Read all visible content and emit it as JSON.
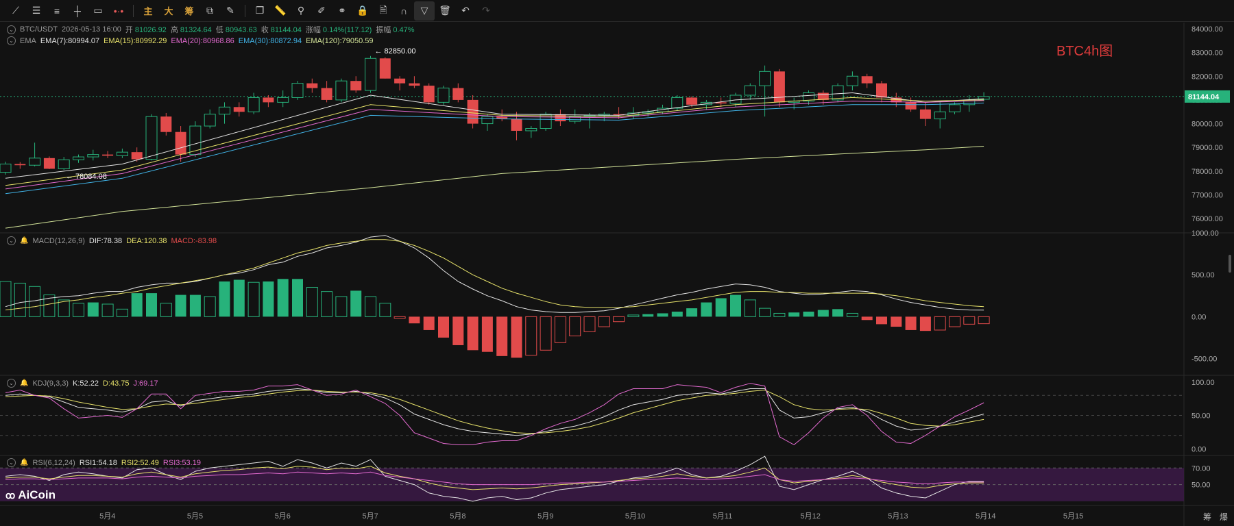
{
  "toolbar": {
    "cn_buttons": [
      "主",
      "大",
      "筹"
    ]
  },
  "header": {
    "symbol": "BTC/USDT",
    "datetime": "2026-05-13 16:00",
    "open_label": "开",
    "open": "81026.92",
    "high_label": "高",
    "high": "81324.64",
    "low_label": "低",
    "low": "80943.63",
    "close_label": "收",
    "close": "81144.04",
    "change_label": "涨幅",
    "change": "0.14%(117.12)",
    "amplitude_label": "振幅",
    "amplitude": "0.47%"
  },
  "ema_legend": {
    "name": "EMA",
    "ema7": "EMA(7):80994.07",
    "ema15": "EMA(15):80992.29",
    "ema20": "EMA(20):80968.86",
    "ema30": "EMA(30):80872.94",
    "ema120": "EMA(120):79050.59"
  },
  "macd_legend": {
    "name": "MACD(12,26,9)",
    "dif": "DIF:78.38",
    "dea": "DEA:120.38",
    "macd": "MACD:-83.98"
  },
  "kdj_legend": {
    "name": "KDJ(9,3,3)",
    "k": "K:52.22",
    "d": "D:43.75",
    "j": "J:69.17"
  },
  "rsi_legend": {
    "name": "RSI(6,12,24)",
    "rsi1": "RSI1:54.18",
    "rsi2": "RSI2:52.49",
    "rsi3": "RSI3:53.19"
  },
  "title_note": "BTC4h图",
  "annotations": {
    "high_marker": "82850.00",
    "low_marker": "78084.08"
  },
  "current_price": "81144.04",
  "logo_text": "AiCoin",
  "bottom_right": [
    "筹",
    "爆"
  ],
  "colors": {
    "up": "#27b27b",
    "down": "#e24b4b",
    "background": "#121212",
    "price_tag": "#27b27b",
    "title_note": "#e03c3c"
  },
  "chart_data": {
    "type": "candlestick",
    "interval": "4h",
    "x_ticks": [
      "5月4",
      "5月5",
      "5月6",
      "5月7",
      "5月8",
      "5月9",
      "5月10",
      "5月11",
      "5月12",
      "5月13",
      "5月14",
      "5月15"
    ],
    "price_axis": {
      "ticks": [
        "84000.00",
        "83000.00",
        "82000.00",
        "81000.00",
        "80000.00",
        "79000.00",
        "78000.00",
        "77000.00",
        "76000.00"
      ],
      "ylim": [
        75400,
        84200
      ]
    },
    "candles": [
      [
        77950,
        78400,
        77850,
        78300
      ],
      [
        78300,
        78380,
        78100,
        78250
      ],
      [
        78250,
        79200,
        78200,
        78550
      ],
      [
        78550,
        78620,
        78084.08,
        78100
      ],
      [
        78100,
        78600,
        78050,
        78480
      ],
      [
        78480,
        78700,
        78350,
        78600
      ],
      [
        78600,
        78900,
        78450,
        78700
      ],
      [
        78700,
        78850,
        78550,
        78650
      ],
      [
        78650,
        78950,
        78550,
        78800
      ],
      [
        78800,
        79000,
        78400,
        78500
      ],
      [
        78500,
        80400,
        78450,
        80300
      ],
      [
        80300,
        80450,
        79500,
        79650
      ],
      [
        79650,
        79900,
        78400,
        78700
      ],
      [
        78700,
        80100,
        78600,
        79900
      ],
      [
        79900,
        80600,
        79800,
        80400
      ],
      [
        80400,
        80900,
        80000,
        80700
      ],
      [
        80700,
        80900,
        80300,
        80500
      ],
      [
        80500,
        81300,
        80400,
        81100
      ],
      [
        81100,
        81200,
        80700,
        80900
      ],
      [
        80900,
        81400,
        80700,
        81100
      ],
      [
        81100,
        81800,
        81000,
        81700
      ],
      [
        81700,
        81900,
        81300,
        81500
      ],
      [
        81500,
        81800,
        80900,
        81000
      ],
      [
        81000,
        81900,
        80900,
        81800
      ],
      [
        81800,
        82000,
        81300,
        81400
      ],
      [
        81400,
        82850,
        81300,
        82750
      ],
      [
        82750,
        82800,
        81900,
        81900
      ],
      [
        81900,
        82000,
        81400,
        81700
      ],
      [
        81700,
        82000,
        81500,
        81600
      ],
      [
        81600,
        81700,
        80800,
        80900
      ],
      [
        80900,
        81600,
        80800,
        81500
      ],
      [
        81500,
        81700,
        80900,
        81000
      ],
      [
        81000,
        81200,
        79800,
        80000
      ],
      [
        80000,
        80400,
        79700,
        80300
      ],
      [
        80300,
        80600,
        80100,
        80200
      ],
      [
        80200,
        80500,
        79300,
        79700
      ],
      [
        79700,
        79900,
        79400,
        79800
      ],
      [
        79800,
        80500,
        79700,
        80400
      ],
      [
        80400,
        80600,
        79900,
        80100
      ],
      [
        80100,
        80600,
        80000,
        80300
      ],
      [
        80300,
        80450,
        79800,
        80350
      ],
      [
        80350,
        80500,
        80100,
        80400
      ],
      [
        80400,
        80700,
        80200,
        80350
      ],
      [
        80350,
        80700,
        80200,
        80450
      ],
      [
        80450,
        80600,
        80300,
        80500
      ],
      [
        80500,
        80800,
        80400,
        80650
      ],
      [
        80650,
        81200,
        80550,
        81100
      ],
      [
        81100,
        81150,
        80700,
        80800
      ],
      [
        80800,
        81000,
        80600,
        80900
      ],
      [
        80900,
        81100,
        80700,
        80850
      ],
      [
        80850,
        81300,
        80700,
        81200
      ],
      [
        81200,
        81700,
        81000,
        81600
      ],
      [
        81600,
        82450,
        80300,
        82200
      ],
      [
        82200,
        82300,
        80700,
        80900
      ],
      [
        80900,
        81100,
        80600,
        80950
      ],
      [
        80950,
        81400,
        80800,
        81300
      ],
      [
        81300,
        81400,
        80800,
        81000
      ],
      [
        81000,
        81700,
        80900,
        81600
      ],
      [
        81600,
        82200,
        81400,
        82000
      ],
      [
        82000,
        82100,
        81500,
        81700
      ],
      [
        81700,
        81800,
        80900,
        81100
      ],
      [
        81100,
        81300,
        80700,
        80900
      ],
      [
        80900,
        81100,
        80500,
        80600
      ],
      [
        80600,
        80900,
        79900,
        80200
      ],
      [
        80200,
        80900,
        79800,
        80500
      ],
      [
        80500,
        80900,
        80400,
        80800
      ],
      [
        80800,
        81200,
        80500,
        81000
      ],
      [
        81026.92,
        81324.64,
        80943.63,
        81144.04
      ]
    ],
    "ema_lines": {
      "ema7": [
        77700,
        78300,
        81200,
        80400,
        80350,
        81000,
        81300,
        80900,
        81050
      ],
      "ema15": [
        77400,
        78050,
        80800,
        80350,
        80300,
        80800,
        81100,
        80950,
        81000
      ],
      "ema20": [
        77250,
        77900,
        80600,
        80300,
        80250,
        80700,
        80950,
        80900,
        80970
      ],
      "ema30": [
        77050,
        77700,
        80350,
        80200,
        80150,
        80550,
        80800,
        80800,
        80870
      ],
      "ema120": [
        75600,
        76300,
        77300,
        77900,
        78200,
        78500,
        78750,
        78900,
        79050
      ]
    },
    "macd": {
      "ticks": [
        "1000.00",
        "500.00",
        "0.00",
        "-500.00"
      ],
      "ylim": [
        -700,
        1000
      ],
      "hist": [
        420,
        400,
        360,
        260,
        200,
        160,
        170,
        150,
        90,
        280,
        280,
        160,
        260,
        260,
        240,
        420,
        440,
        410,
        420,
        450,
        450,
        350,
        300,
        240,
        310,
        240,
        160,
        -20,
        -80,
        -160,
        -250,
        -340,
        -400,
        -420,
        -470,
        -490,
        -460,
        -400,
        -310,
        -230,
        -180,
        -120,
        -60,
        20,
        30,
        40,
        60,
        100,
        170,
        220,
        260,
        200,
        100,
        40,
        50,
        60,
        80,
        90,
        40,
        -40,
        -90,
        -120,
        -160,
        -170,
        -160,
        -120,
        -90,
        -84
      ],
      "dif": [
        120,
        170,
        190,
        220,
        240,
        250,
        280,
        300,
        300,
        350,
        380,
        400,
        400,
        420,
        460,
        500,
        520,
        560,
        620,
        650,
        720,
        760,
        820,
        850,
        890,
        950,
        970,
        900,
        820,
        700,
        550,
        420,
        330,
        250,
        190,
        120,
        80,
        60,
        50,
        50,
        60,
        70,
        100,
        140,
        180,
        220,
        260,
        290,
        330,
        360,
        390,
        380,
        350,
        300,
        280,
        260,
        270,
        290,
        310,
        300,
        260,
        210,
        170,
        140,
        110,
        90,
        80,
        78
      ],
      "dea": [
        80,
        100,
        120,
        150,
        180,
        200,
        230,
        250,
        280,
        300,
        340,
        370,
        400,
        430,
        460,
        500,
        540,
        580,
        640,
        700,
        760,
        800,
        850,
        880,
        900,
        920,
        920,
        900,
        850,
        780,
        700,
        600,
        500,
        420,
        340,
        280,
        230,
        180,
        140,
        120,
        110,
        110,
        110,
        120,
        140,
        160,
        180,
        200,
        230,
        260,
        290,
        300,
        300,
        290,
        290,
        280,
        280,
        280,
        280,
        280,
        270,
        250,
        220,
        190,
        170,
        150,
        130,
        120
      ]
    },
    "kdj": {
      "ticks": [
        "100.00",
        "50.00",
        "0.00"
      ],
      "ylim": [
        -10,
        110
      ],
      "k": [
        80,
        82,
        80,
        78,
        70,
        62,
        60,
        58,
        55,
        60,
        70,
        72,
        64,
        72,
        75,
        78,
        80,
        82,
        86,
        88,
        90,
        88,
        84,
        84,
        86,
        82,
        76,
        66,
        52,
        44,
        36,
        30,
        26,
        24,
        22,
        20,
        22,
        26,
        30,
        34,
        40,
        48,
        58,
        66,
        70,
        74,
        80,
        82,
        84,
        82,
        86,
        90,
        90,
        58,
        46,
        48,
        54,
        60,
        62,
        56,
        44,
        34,
        28,
        30,
        34,
        40,
        46,
        52
      ],
      "d": [
        78,
        79,
        80,
        79,
        75,
        70,
        66,
        62,
        59,
        60,
        64,
        67,
        66,
        68,
        71,
        74,
        77,
        79,
        82,
        85,
        87,
        88,
        86,
        85,
        85,
        84,
        80,
        74,
        66,
        58,
        50,
        42,
        36,
        31,
        27,
        24,
        23,
        24,
        26,
        29,
        33,
        39,
        46,
        54,
        60,
        66,
        72,
        76,
        80,
        81,
        83,
        86,
        88,
        78,
        66,
        60,
        58,
        59,
        60,
        59,
        53,
        46,
        38,
        35,
        34,
        36,
        40,
        44
      ],
      "j": [
        84,
        88,
        80,
        76,
        60,
        46,
        48,
        50,
        47,
        60,
        82,
        82,
        60,
        80,
        83,
        86,
        86,
        88,
        94,
        94,
        96,
        88,
        80,
        82,
        88,
        78,
        68,
        50,
        24,
        16,
        8,
        6,
        6,
        10,
        12,
        12,
        20,
        30,
        38,
        44,
        54,
        66,
        82,
        90,
        90,
        90,
        96,
        94,
        92,
        84,
        92,
        98,
        94,
        18,
        6,
        24,
        46,
        62,
        66,
        50,
        26,
        10,
        8,
        20,
        34,
        48,
        58,
        69
      ]
    },
    "rsi": {
      "ticks": [
        "70.00",
        "50.00"
      ],
      "ylim": [
        25,
        85
      ],
      "rsi1": [
        60,
        62,
        60,
        55,
        62,
        65,
        63,
        60,
        58,
        68,
        70,
        62,
        56,
        66,
        70,
        72,
        74,
        76,
        78,
        72,
        80,
        76,
        70,
        76,
        72,
        80,
        60,
        55,
        50,
        40,
        36,
        34,
        30,
        34,
        36,
        32,
        34,
        40,
        44,
        46,
        48,
        50,
        54,
        58,
        60,
        64,
        70,
        62,
        58,
        60,
        66,
        74,
        84,
        48,
        44,
        50,
        56,
        60,
        66,
        58,
        46,
        40,
        36,
        34,
        42,
        50,
        54,
        54
      ],
      "rsi2": [
        58,
        59,
        59,
        57,
        59,
        61,
        61,
        60,
        59,
        63,
        65,
        62,
        59,
        63,
        65,
        67,
        68,
        70,
        71,
        69,
        72,
        71,
        68,
        70,
        69,
        72,
        64,
        60,
        57,
        52,
        48,
        46,
        44,
        45,
        46,
        45,
        46,
        48,
        50,
        51,
        52,
        53,
        55,
        57,
        58,
        60,
        63,
        60,
        58,
        59,
        61,
        65,
        70,
        56,
        52,
        54,
        56,
        58,
        61,
        58,
        53,
        50,
        47,
        46,
        49,
        51,
        52,
        52
      ],
      "rsi3": [
        56,
        57,
        57,
        56,
        57,
        58,
        58,
        58,
        57,
        59,
        60,
        59,
        58,
        60,
        61,
        62,
        62,
        63,
        64,
        63,
        65,
        64,
        63,
        64,
        63,
        65,
        61,
        59,
        57,
        55,
        53,
        51,
        50,
        50,
        50,
        50,
        50,
        51,
        52,
        52,
        53,
        53,
        54,
        55,
        56,
        57,
        58,
        57,
        56,
        57,
        58,
        60,
        62,
        56,
        54,
        55,
        56,
        57,
        58,
        57,
        55,
        53,
        52,
        51,
        52,
        53,
        53,
        53
      ]
    }
  }
}
